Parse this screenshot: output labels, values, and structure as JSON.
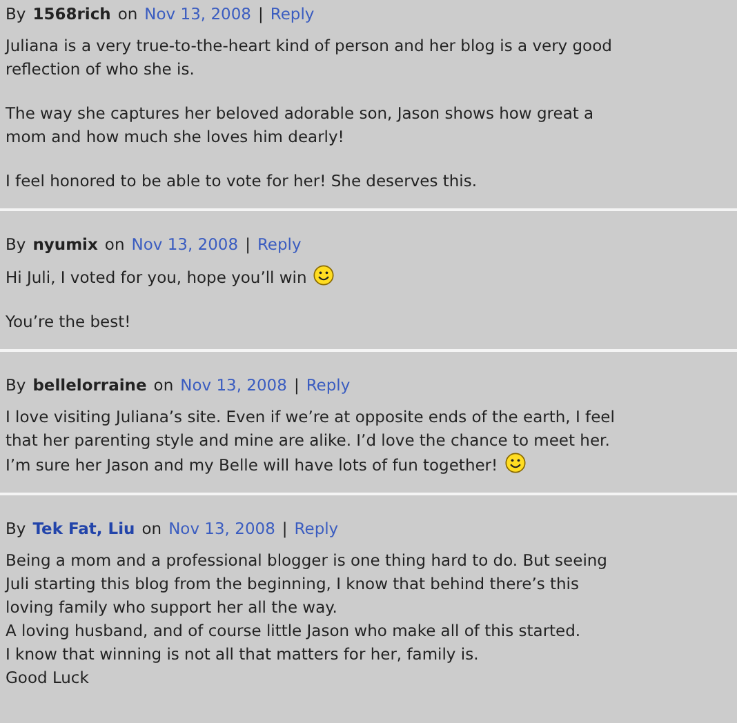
{
  "comments": [
    {
      "by_label": "By",
      "author": {
        "name": "1568rich",
        "kind": "plain"
      },
      "on_label": "on",
      "date": "Nov 13, 2008",
      "separator": "|",
      "reply": "Reply",
      "paragraphs": [
        {
          "lines": [
            "Juliana is a very true-to-the-heart kind of person and her blog is a very good",
            "reflection of who she is."
          ],
          "emoticon": false
        },
        {
          "lines": [
            "The way she captures her beloved adorable son, Jason shows how great a",
            "mom and how much she loves him dearly!"
          ],
          "emoticon": false
        },
        {
          "lines": [
            "I feel honored to be able to vote for her! She deserves this."
          ],
          "emoticon": false
        }
      ]
    },
    {
      "by_label": "By",
      "author": {
        "name": "nyumix",
        "kind": "plain"
      },
      "on_label": "on",
      "date": "Nov 13, 2008",
      "separator": "|",
      "reply": "Reply",
      "paragraphs": [
        {
          "lines": [
            "Hi Juli, I voted for you, hope you’ll win"
          ],
          "emoticon": true
        },
        {
          "lines": [
            "You’re the best!"
          ],
          "emoticon": false
        }
      ]
    },
    {
      "by_label": "By",
      "author": {
        "name": "bellelorraine",
        "kind": "plain"
      },
      "on_label": "on",
      "date": "Nov 13, 2008",
      "separator": "|",
      "reply": "Reply",
      "paragraphs": [
        {
          "lines": [
            "I love visiting Juliana’s site. Even if we’re at opposite ends of the earth, I feel",
            "that her parenting style and mine are alike. I’d love the chance to meet her.",
            "I’m sure her Jason and my Belle will have lots of fun together!"
          ],
          "emoticon": true
        }
      ]
    },
    {
      "by_label": "By",
      "author": {
        "name": "Tek Fat, Liu",
        "kind": "link"
      },
      "on_label": "on",
      "date": "Nov 13, 2008",
      "separator": "|",
      "reply": "Reply",
      "paragraphs": [
        {
          "lines": [
            "Being a mom and a professional blogger is one thing hard to do. But seeing",
            "Juli starting this blog from the beginning, I know that behind there’s this",
            "loving family who support her all the way.",
            "A loving husband, and of course little Jason who make all of this started.",
            "I know that winning is not all that matters for her, family is.",
            "Good Luck"
          ],
          "emoticon": false
        }
      ]
    }
  ]
}
